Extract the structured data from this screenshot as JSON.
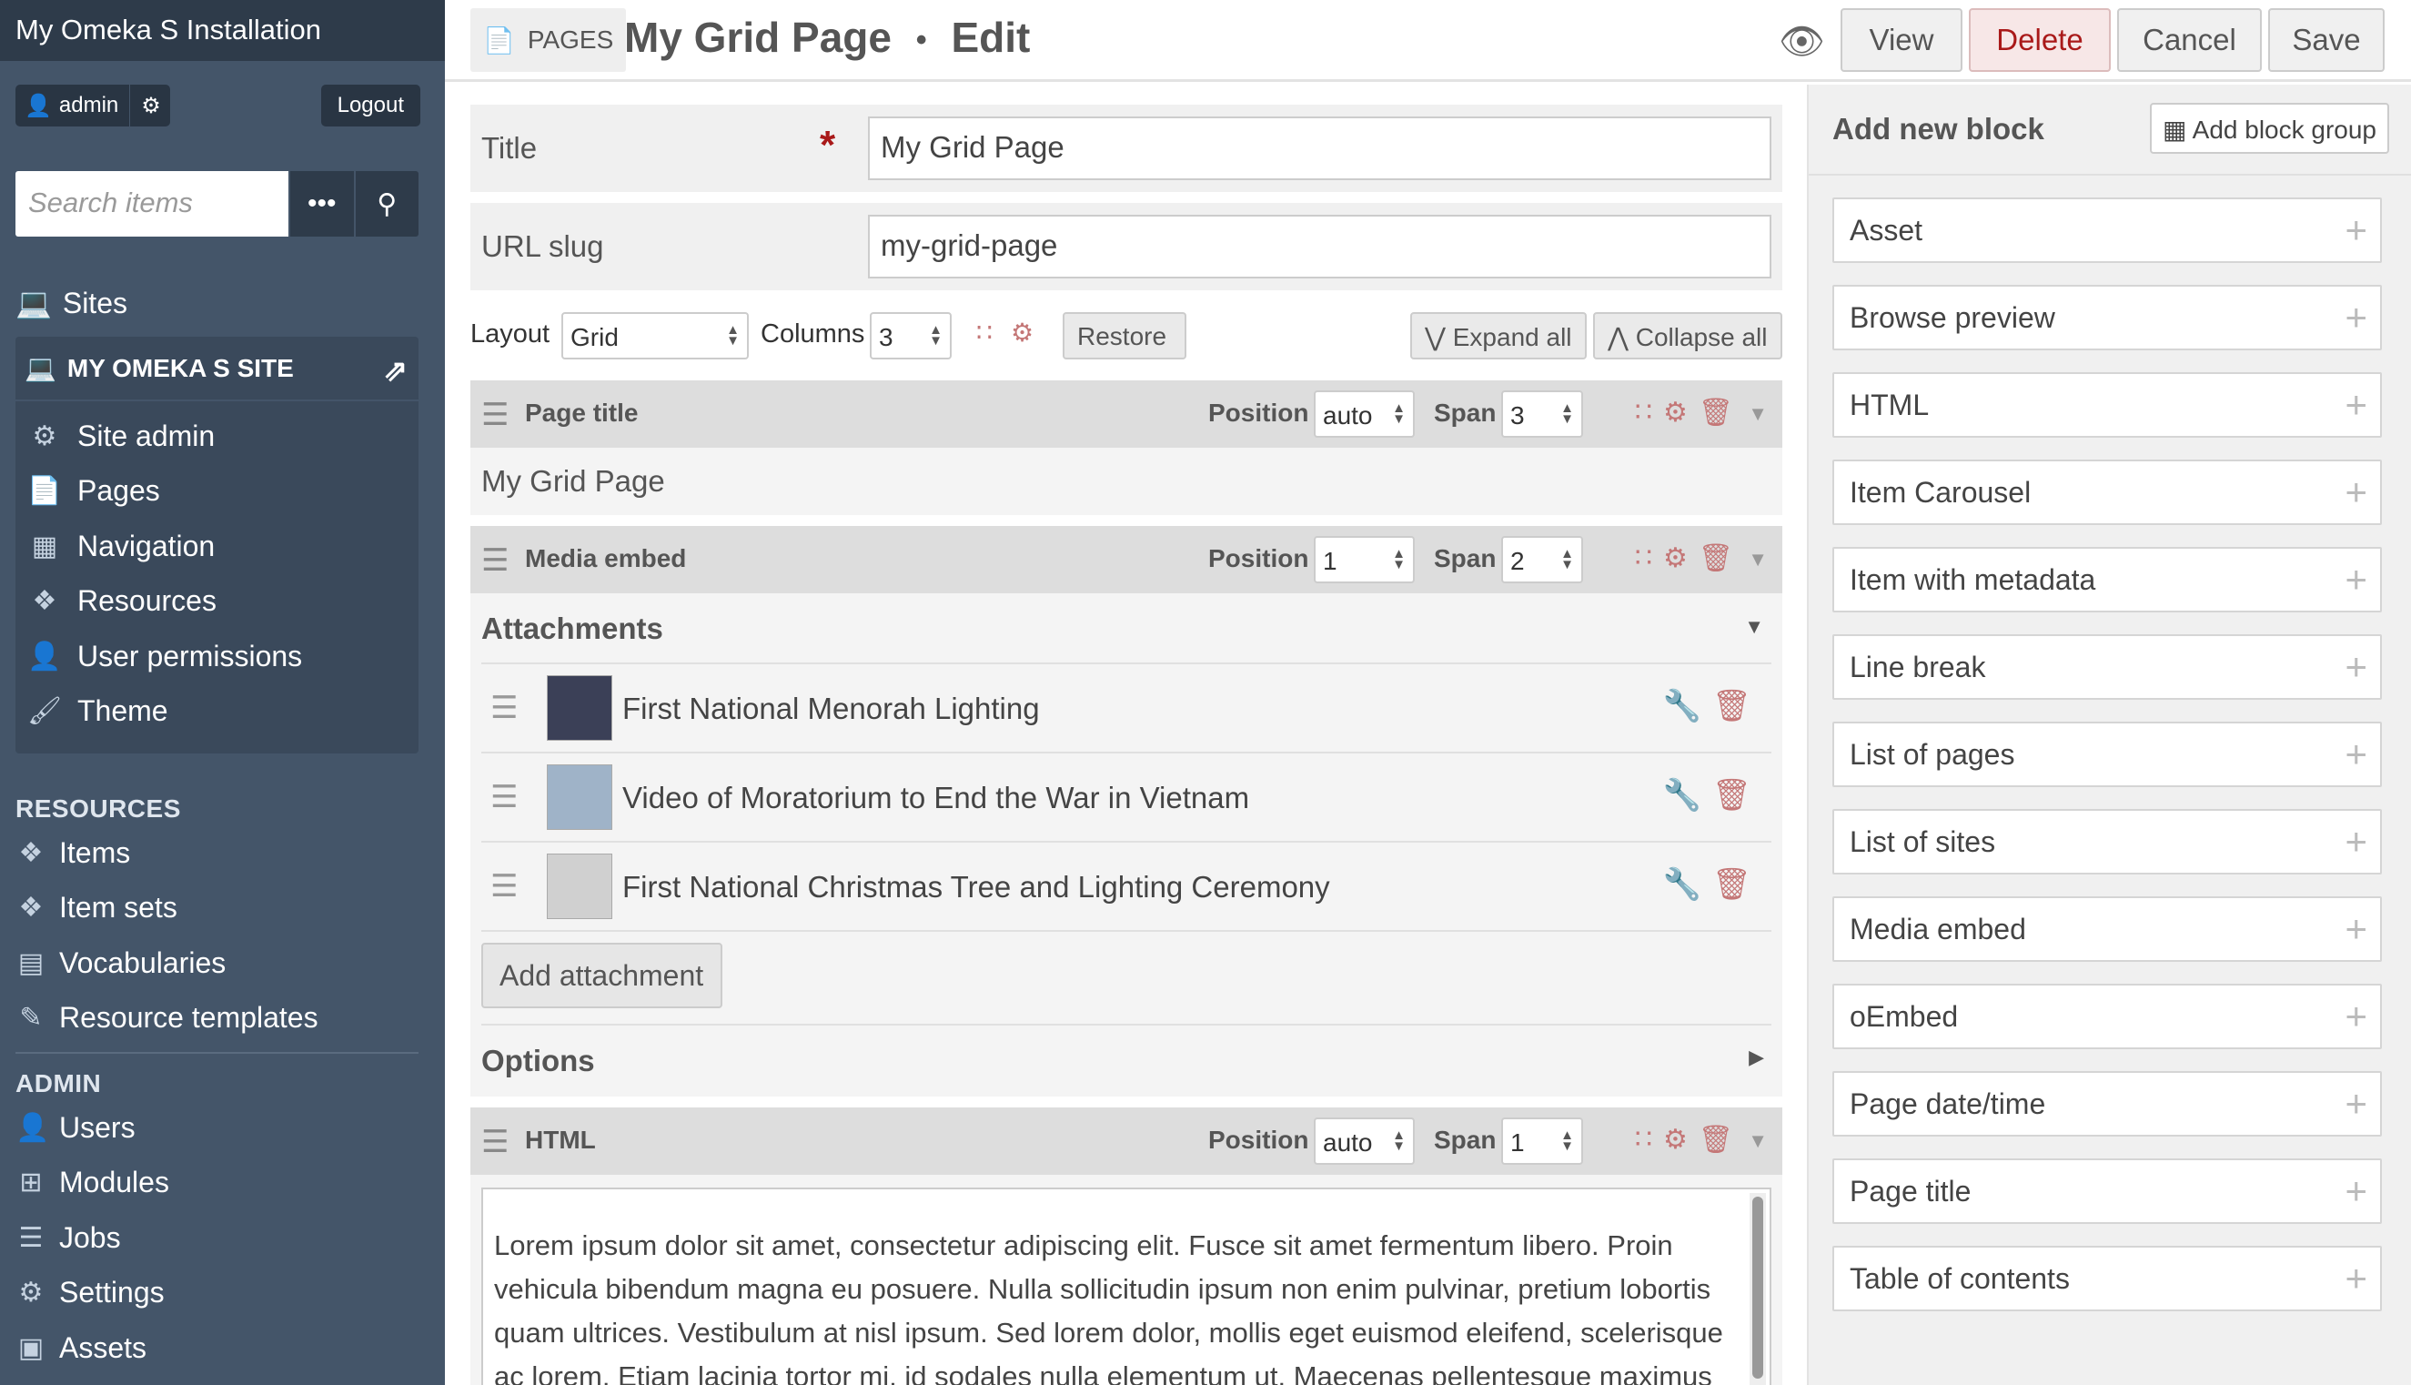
{
  "brand": "My Omeka S Installation",
  "user": {
    "name": "admin",
    "logout": "Logout"
  },
  "search": {
    "placeholder": "Search items"
  },
  "sites_label": "Sites",
  "site": {
    "name": "MY OMEKA S SITE",
    "items": [
      {
        "label": "Site admin",
        "icon": "cogs-icon"
      },
      {
        "label": "Pages",
        "icon": "page-icon"
      },
      {
        "label": "Navigation",
        "icon": "sitemap-icon"
      },
      {
        "label": "Resources",
        "icon": "cubes-icon"
      },
      {
        "label": "User permissions",
        "icon": "user-icon"
      },
      {
        "label": "Theme",
        "icon": "brush-icon"
      }
    ]
  },
  "resources": {
    "heading": "RESOURCES",
    "items": [
      {
        "label": "Items"
      },
      {
        "label": "Item sets"
      },
      {
        "label": "Vocabularies"
      },
      {
        "label": "Resource templates"
      }
    ]
  },
  "admin": {
    "heading": "ADMIN",
    "items": [
      {
        "label": "Users"
      },
      {
        "label": "Modules"
      },
      {
        "label": "Jobs"
      },
      {
        "label": "Settings"
      },
      {
        "label": "Assets"
      }
    ]
  },
  "topbar": {
    "crumb": "PAGES",
    "title": "My Grid Page",
    "sep": "•",
    "mode": "Edit",
    "view": "View",
    "delete": "Delete",
    "cancel": "Cancel",
    "save": "Save"
  },
  "form": {
    "title_label": "Title",
    "title_value": "My Grid Page",
    "slug_label": "URL slug",
    "slug_value": "my-grid-page",
    "layout_label": "Layout",
    "layout_value": "Grid",
    "columns_label": "Columns",
    "columns_value": "3",
    "restore": "Restore",
    "expand_all": "Expand all",
    "collapse_all": "Collapse all"
  },
  "blocks": {
    "position_label": "Position",
    "span_label": "Span",
    "page_title": {
      "name": "Page title",
      "position": "auto",
      "span": "3",
      "content": "My Grid Page"
    },
    "media": {
      "name": "Media embed",
      "position": "1",
      "span": "2",
      "attachments_label": "Attachments",
      "attachments": [
        "First National Menorah Lighting",
        "Video of Moratorium to End the War in Vietnam",
        "First National Christmas Tree and Lighting Ceremony"
      ],
      "add_attachment": "Add attachment",
      "options_label": "Options"
    },
    "html": {
      "name": "HTML",
      "position": "auto",
      "span": "1",
      "content": "Lorem ipsum dolor sit amet, consectetur adipiscing elit. Fusce sit amet fermentum libero. Proin vehicula bibendum magna eu posuere. Nulla sollicitudin ipsum non enim pulvinar, pretium lobortis quam ultrices. Vestibulum at nisl ipsum. Sed lorem dolor, mollis eget euismod eleifend, scelerisque ac lorem. Etiam lacinia tortor mi, id sodales nulla elementum ut. Maecenas pellentesque maximus"
    }
  },
  "panel": {
    "title": "Add new block",
    "add_group": "Add block group",
    "blocks": [
      "Asset",
      "Browse preview",
      "HTML",
      "Item Carousel",
      "Item with metadata",
      "Line break",
      "List of pages",
      "List of sites",
      "Media embed",
      "oEmbed",
      "Page date/time",
      "Page title",
      "Table of contents"
    ]
  }
}
